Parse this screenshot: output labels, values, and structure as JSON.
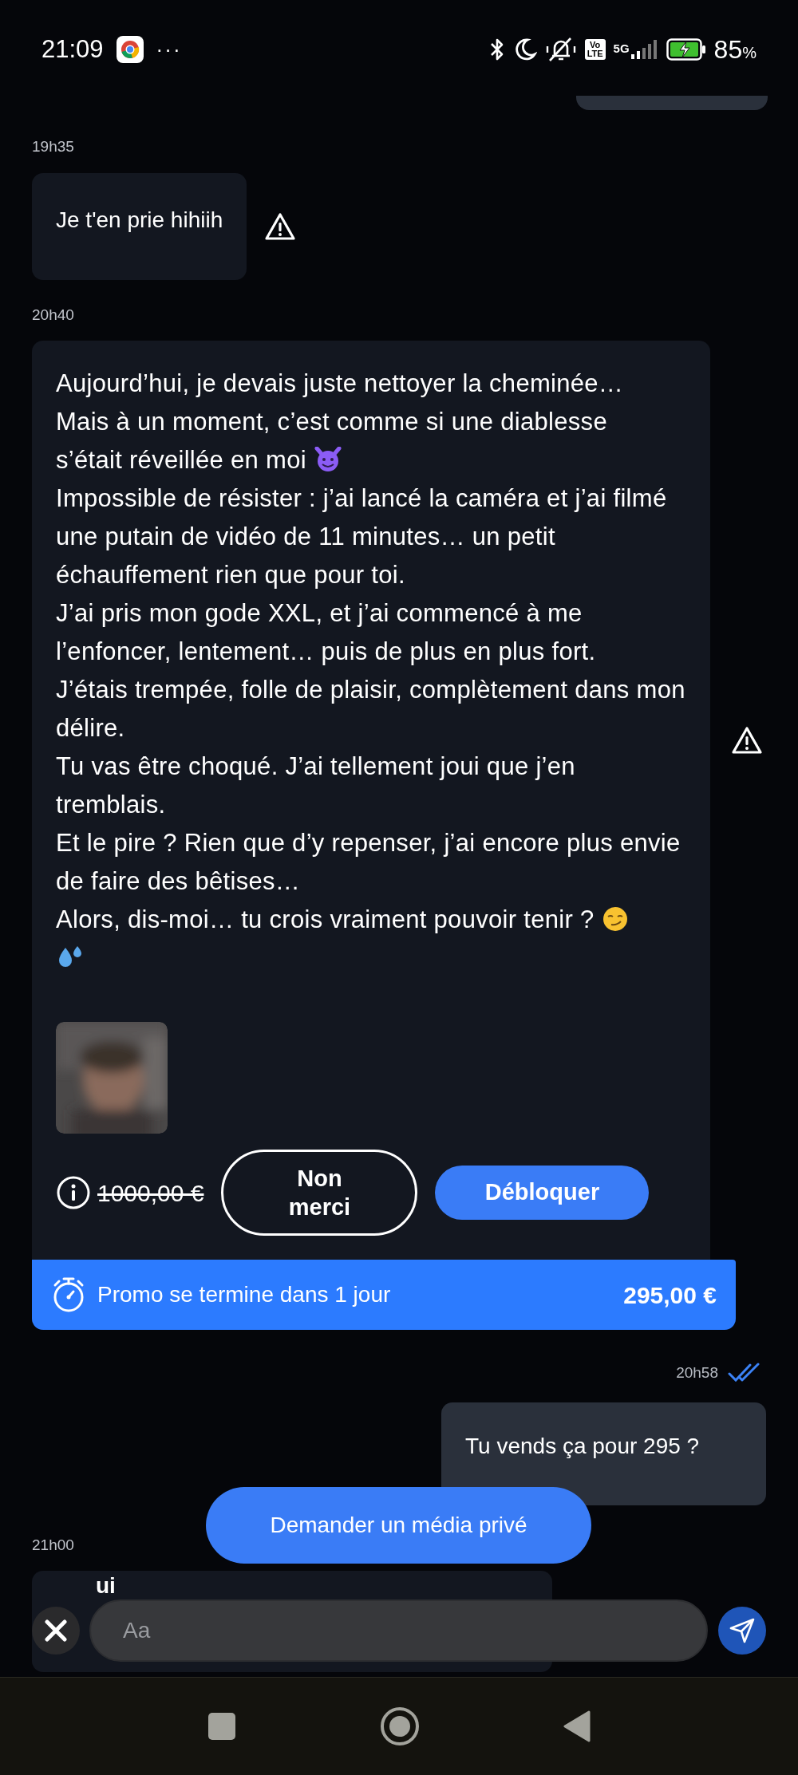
{
  "status_bar": {
    "time": "21:09",
    "more": "···",
    "battery_percent": "85",
    "percent_sign": "%",
    "network": "5G",
    "volte": "Vo\nLTE"
  },
  "conversation": [
    {
      "kind": "edge"
    },
    {
      "kind": "time",
      "text": "19h35"
    },
    {
      "kind": "received",
      "text": "Je t'en prie hihiih",
      "warning": true
    },
    {
      "kind": "time",
      "text": "20h40"
    },
    {
      "kind": "paid_media",
      "warning": true,
      "paragraphs": [
        {
          "text": "Aujourd’hui, je devais juste nettoyer la cheminée…"
        },
        {
          "text": "Mais à un moment, c’est comme si une diablesse"
        },
        {
          "text": "s’était réveillée en moi",
          "trailing": [
            {
              "kind": "devil"
            }
          ]
        },
        {
          "text": "Impossible de résister : j’ai lancé la caméra et j’ai filmé une putain de vidéo de 11 minutes… un petit échauffement rien que pour toi."
        },
        {
          "text": "J’ai pris mon gode XXL, et j’ai commencé à me l’enfoncer, lentement… puis de plus en plus fort."
        },
        {
          "text": "J’étais trempée, folle de plaisir, complètement dans mon délire."
        },
        {
          "text": "Tu vas être choqué. J’ai tellement joui que j’en tremblais."
        },
        {
          "text": "Et le pire ? Rien que d’y repenser, j’ai encore plus envie de faire des bêtises…"
        },
        {
          "text": "Alors, dis-moi… tu crois vraiment pouvoir tenir ?",
          "trailing": [
            {
              "kind": "smirk"
            },
            {
              "kind": "droplets",
              "new_line": true
            }
          ]
        }
      ],
      "old_price": "1000,00 €",
      "decline": "Non merci",
      "unlock": "Débloquer",
      "promo": {
        "text": "Promo se termine dans 1 jour",
        "price": "295,00 €"
      }
    },
    {
      "kind": "time_read",
      "text": "20h58",
      "read": true
    },
    {
      "kind": "sent",
      "text": "Tu vends ça pour 295 ?"
    },
    {
      "kind": "time",
      "text": "21h00"
    },
    {
      "kind": "covered",
      "text": "ui"
    }
  ],
  "request_button": "Demander un média privé",
  "composer": {
    "placeholder": "Aa"
  }
}
